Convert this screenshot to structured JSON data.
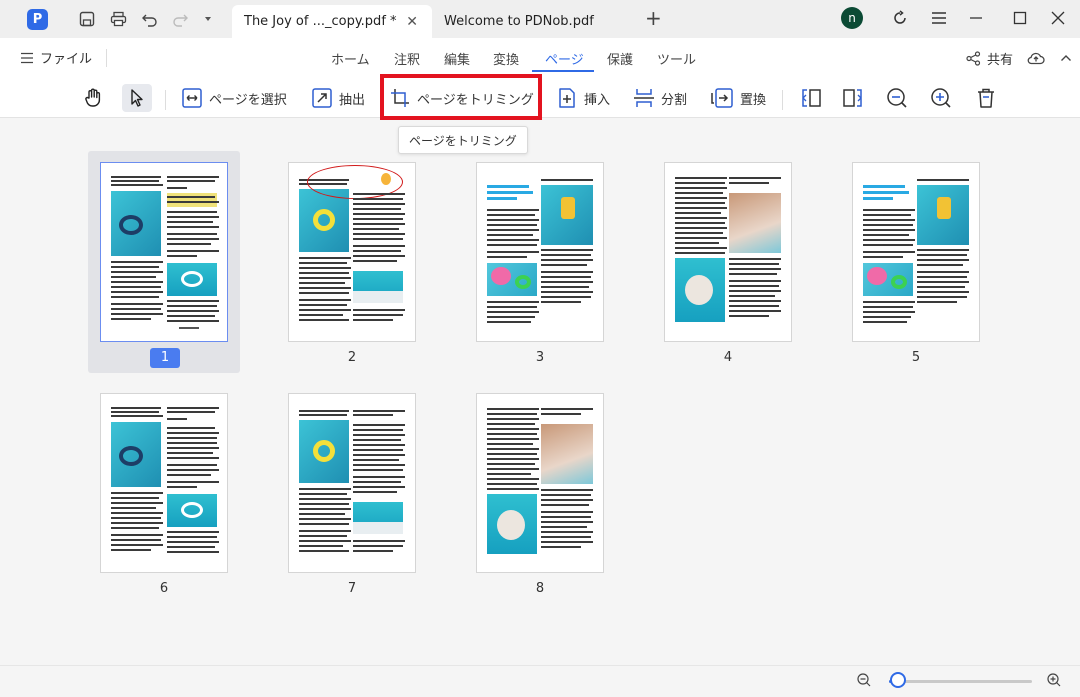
{
  "titlebar": {
    "tabs": [
      {
        "label": "The Joy of ..._copy.pdf *",
        "active": true
      },
      {
        "label": "Welcome to PDNob.pdf",
        "active": false
      }
    ],
    "avatar_letter": "n"
  },
  "menubar": {
    "file_label": "ファイル",
    "items": [
      "ホーム",
      "注釈",
      "編集",
      "変換",
      "ページ",
      "保護",
      "ツール"
    ],
    "active_item": "ページ",
    "share_label": "共有"
  },
  "toolbar": {
    "select_page": "ページを選択",
    "extract": "抽出",
    "crop_page": "ページをトリミング",
    "insert": "挿入",
    "split": "分割",
    "replace": "置換"
  },
  "tooltip": "ページをトリミング",
  "pages": [
    {
      "number": "1",
      "selected": true
    },
    {
      "number": "2",
      "selected": false
    },
    {
      "number": "3",
      "selected": false
    },
    {
      "number": "4",
      "selected": false
    },
    {
      "number": "5",
      "selected": false
    },
    {
      "number": "6",
      "selected": false
    },
    {
      "number": "7",
      "selected": false
    },
    {
      "number": "8",
      "selected": false
    }
  ],
  "zoom": {
    "level_fraction": 0.06
  },
  "colors": {
    "accent": "#2f6ae6",
    "highlight": "#e3131f",
    "selection_bg": "#e2e3e7"
  }
}
